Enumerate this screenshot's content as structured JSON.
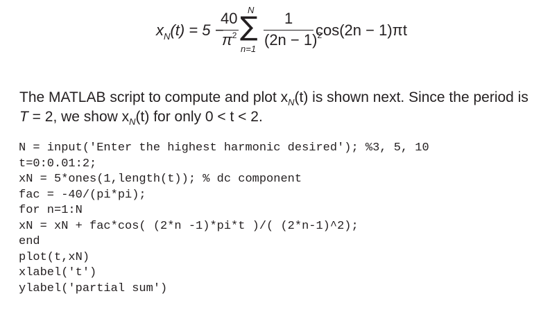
{
  "equation": {
    "lhs_var": "x",
    "lhs_sub": "N",
    "lhs_arg": "(t) = 5 −",
    "frac1_num": "40",
    "frac1_den": "π",
    "frac1_den_exp": "2",
    "sum_symbol": "∑",
    "sum_upper": "N",
    "sum_lower": "n=1",
    "frac2_num": "1",
    "frac2_den": "(2n − 1)",
    "frac2_den_exp": "2",
    "trailing": "cos(2n − 1)πt"
  },
  "paragraph": {
    "line1_a": "The MATLAB script to compute and plot x",
    "line1_sub": "N",
    "line1_b": "(t) is shown next. Since the period is",
    "line2_a": "T",
    "line2_b": " = 2, we show x",
    "line2_sub": "N",
    "line2_c": "(t) for only 0 < t < 2."
  },
  "code_lines": [
    "N = input('Enter the highest harmonic desired'); %3, 5, 10",
    "t=0:0.01:2;",
    "xN = 5*ones(1,length(t)); % dc component",
    "fac = -40/(pi*pi);",
    "for n=1:N",
    "xN = xN + fac*cos( (2*n -1)*pi*t )/( (2*n-1)^2);",
    "end",
    "plot(t,xN)",
    "xlabel('t')",
    "ylabel('partial sum')"
  ]
}
